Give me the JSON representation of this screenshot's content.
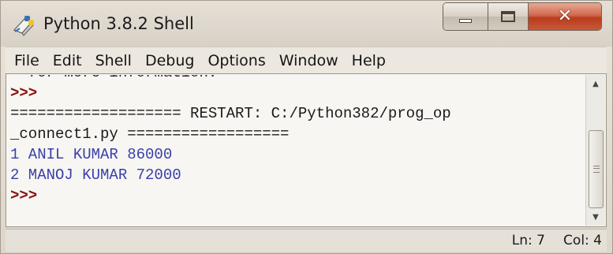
{
  "window": {
    "title": "Python 3.8.2 Shell",
    "close_glyph": "✕"
  },
  "menu": [
    "File",
    "Edit",
    "Shell",
    "Debug",
    "Options",
    "Window",
    "Help"
  ],
  "shell": {
    "clipped_line": "  for more information.",
    "prompt1": ">>>",
    "restart_line1": "=================== RESTART: C:/Python382/prog_op",
    "restart_line2": "_connect1.py ==================",
    "output": [
      "1 ANIL KUMAR 86000",
      "2 MANOJ KUMAR 72000"
    ],
    "prompt2": ">>>"
  },
  "status": {
    "ln": "Ln: 7",
    "col": "Col: 4"
  },
  "colors": {
    "prompt": "#8a0f0f",
    "output": "#3b3fa8",
    "close_button": "#c9573a"
  },
  "icons": [
    "python-idle-icon",
    "minimize-icon",
    "maximize-icon",
    "close-icon",
    "scroll-up-icon",
    "scroll-down-icon"
  ]
}
